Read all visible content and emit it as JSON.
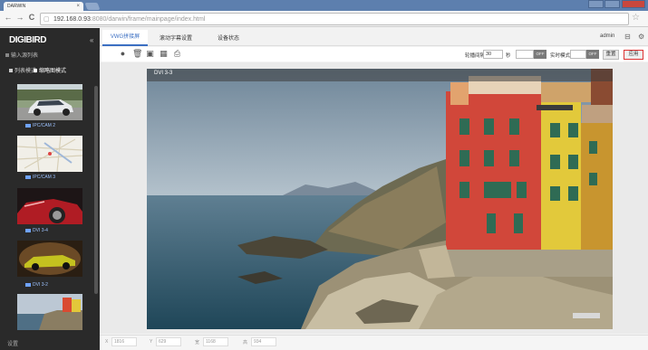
{
  "browser": {
    "tab_title": "DARWIN",
    "tab_close": "×",
    "url_host": "192.168.0.93",
    "url_rest": ":8080/darwin/frame/mainpage/index.html",
    "page_icon": "▢",
    "star": "☆",
    "nav": {
      "back": "←",
      "forward": "→",
      "reload": "C"
    }
  },
  "sidebar": {
    "logo": "DIGIBIRD",
    "collapse": "«",
    "input_title": "输入源列表",
    "view_list": "列表模式",
    "view_thumb": "缩略图模式",
    "thumbnails": [
      {
        "label": "IPC/CAM 2",
        "icon": "camera-icon"
      },
      {
        "label": "IPC/CAM 3",
        "icon": "camera-icon"
      },
      {
        "label": "DVI 3-4",
        "icon": "camera-icon"
      },
      {
        "label": "DVI 3-2",
        "icon": "camera-icon"
      },
      {
        "label": "",
        "icon": "camera-icon"
      }
    ],
    "settings": "设置"
  },
  "header": {
    "tabs": [
      "VWG拼接屏",
      "滚动字幕设置",
      "设备状态"
    ],
    "user": "admin",
    "icons": [
      "monitor-icon",
      "settings-icon"
    ]
  },
  "opbar": {
    "icons": [
      "add-icon",
      "delete-icon",
      "save-icon",
      "grid-icon",
      "print-icon"
    ],
    "switch_label": "轮播间隔",
    "switch_value": "30",
    "switch_unit": "秒",
    "toggle1": "OFF",
    "realtime_label": "实时模式",
    "toggle2": "OFF",
    "reset": "重置",
    "apply": "应用"
  },
  "canvas": {
    "window_title": "DVI 3-3"
  },
  "status": {
    "x_label": "X",
    "x_value": "1816",
    "y_label": "Y",
    "y_value": "629",
    "w_label": "宽",
    "w_value": "1168",
    "h_label": "高",
    "h_value": "934"
  },
  "colors": {
    "accent": "#3b6fc2",
    "chrome": "#5d7fae",
    "sidebar": "#2a2a2a",
    "apply_border": "#dd3333"
  }
}
